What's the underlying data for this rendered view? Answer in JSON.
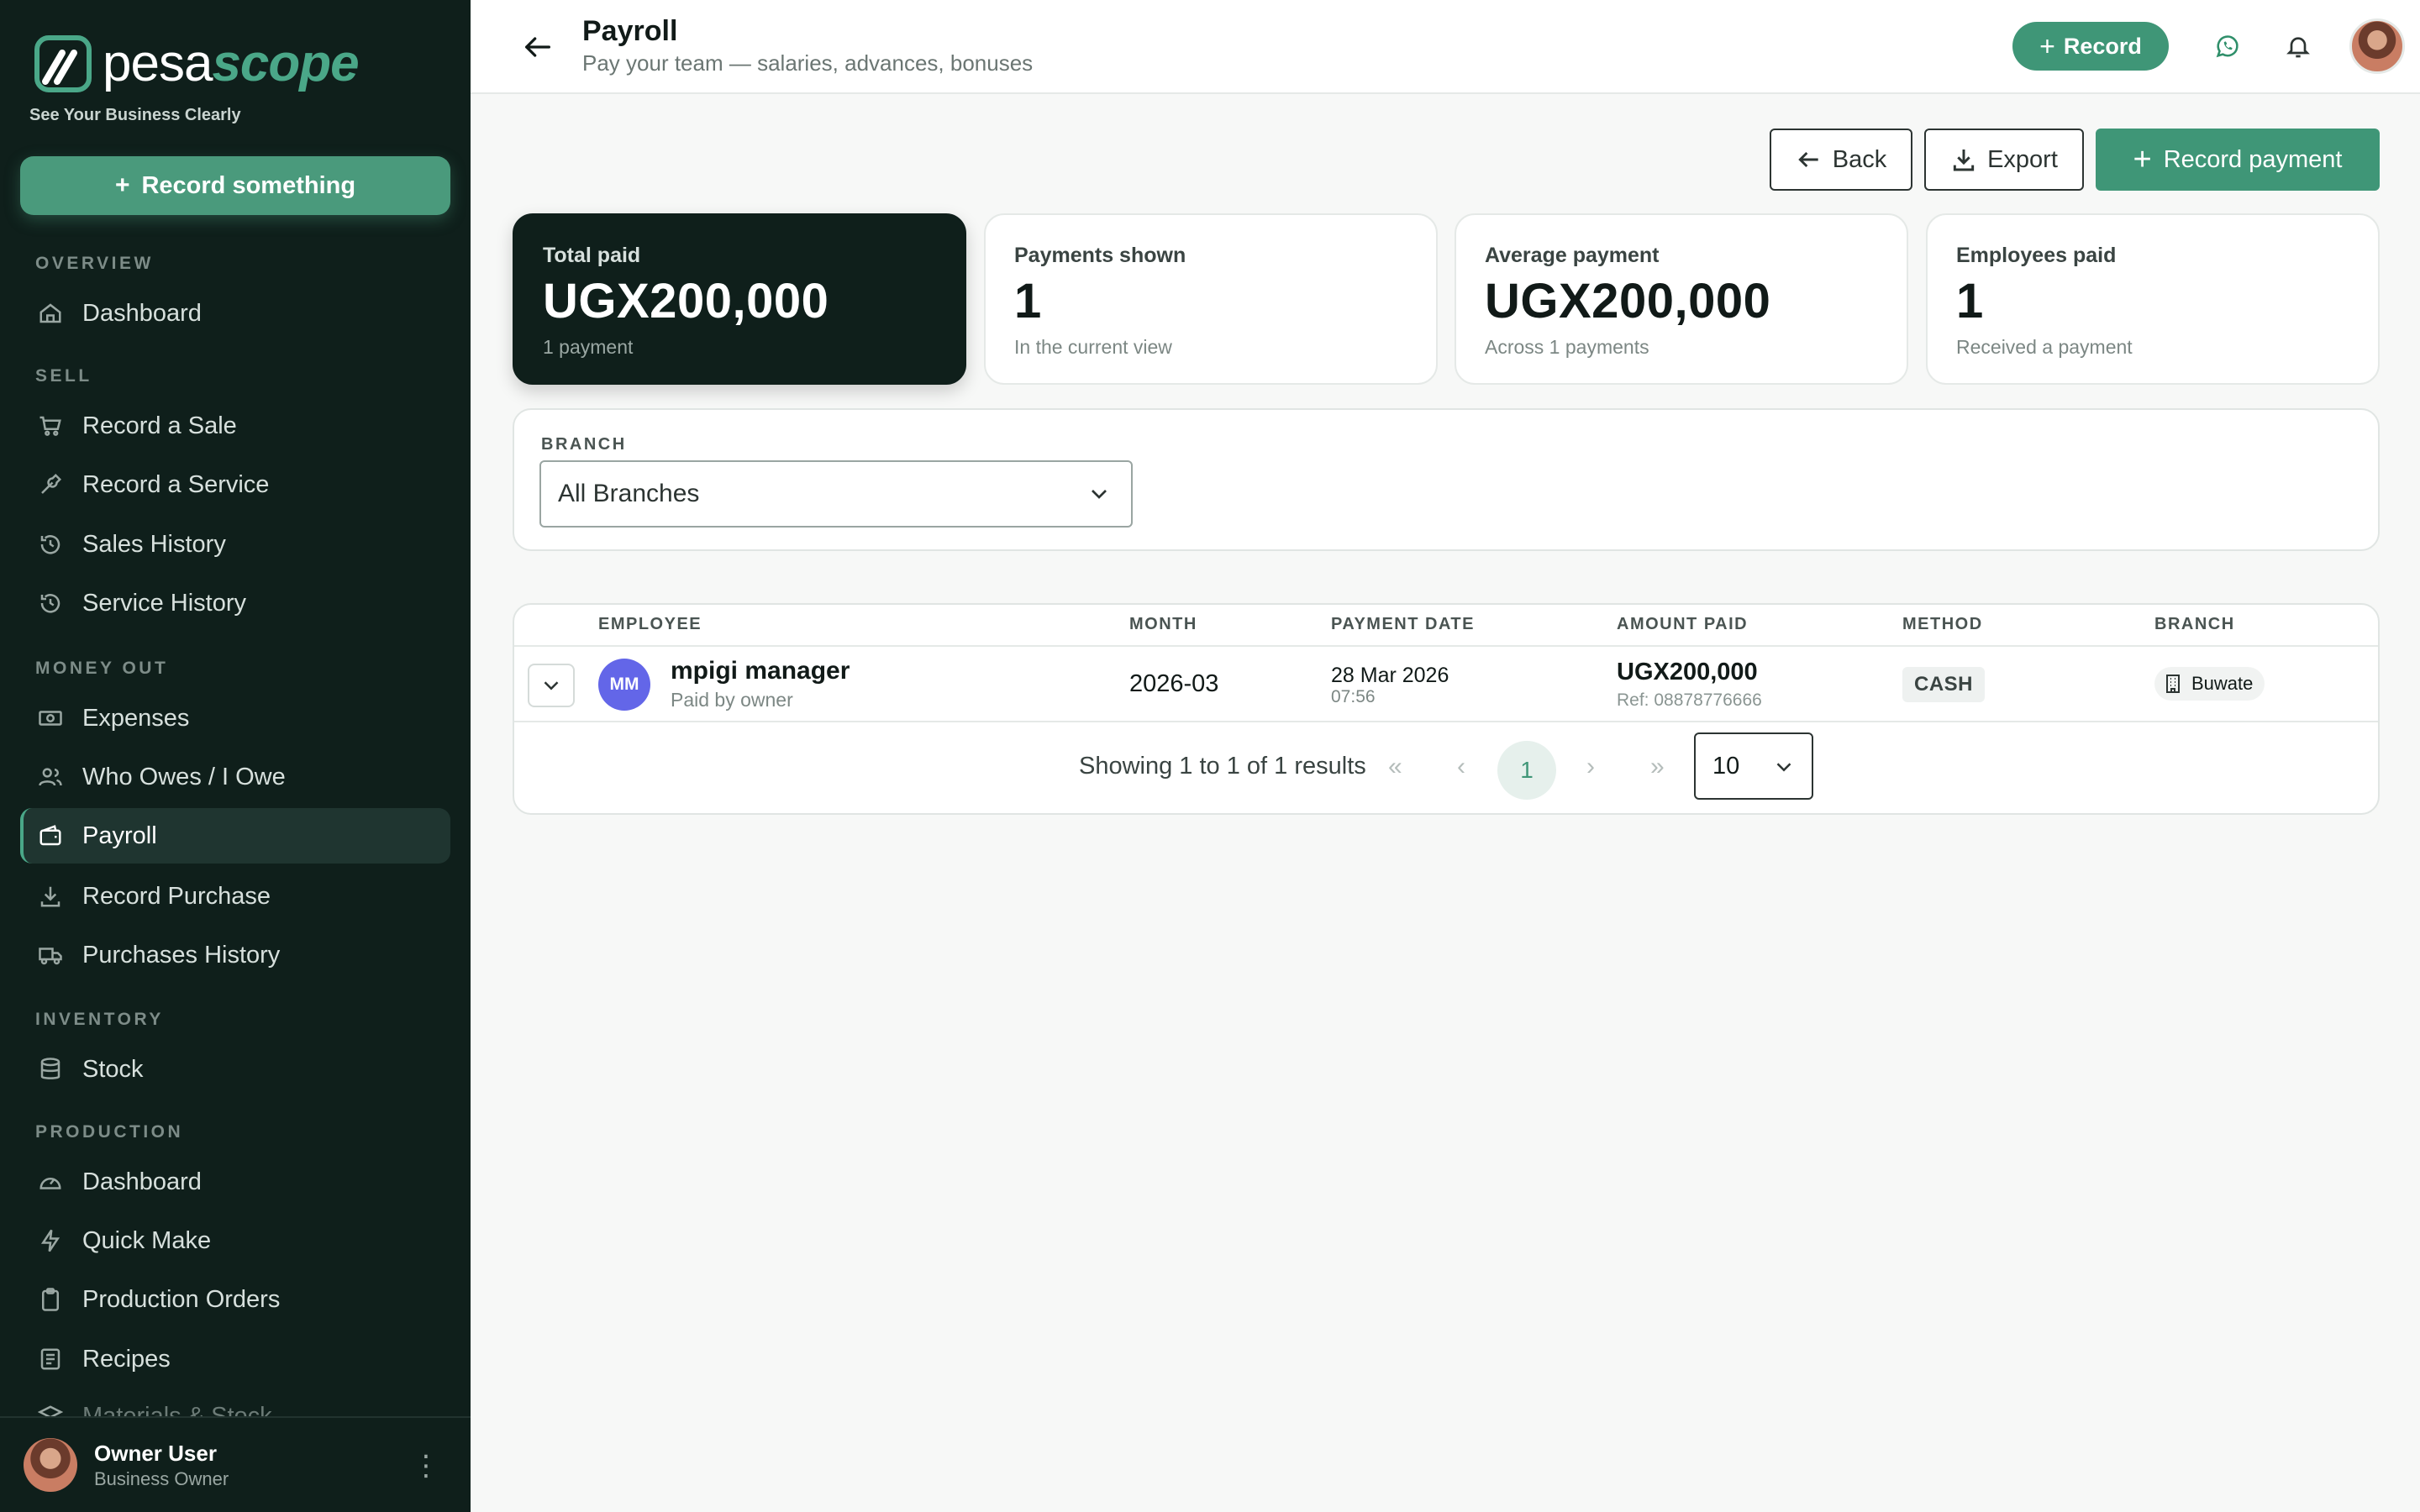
{
  "brand": {
    "name_part1": "pesa",
    "name_part2": "scope",
    "tagline": "See Your Business Clearly",
    "accent_color": "#3f9677",
    "sidebar_bg": "#0f1f1b"
  },
  "sidebar": {
    "cta_label": "Record something",
    "sections": {
      "overview": "OVERVIEW",
      "sell": "SELL",
      "money_out": "MONEY OUT",
      "inventory": "INVENTORY",
      "production": "PRODUCTION"
    },
    "items": {
      "dashboard": "Dashboard",
      "record_sale": "Record a Sale",
      "record_service": "Record a Service",
      "sales_history": "Sales History",
      "service_history": "Service History",
      "expenses": "Expenses",
      "who_owes": "Who Owes / I Owe",
      "payroll": "Payroll",
      "record_purchase": "Record Purchase",
      "purchases_history": "Purchases History",
      "stock": "Stock",
      "production_dashboard": "Dashboard",
      "quick_make": "Quick Make",
      "production_orders": "Production Orders",
      "recipes": "Recipes",
      "materials_stock": "Materials & Stock"
    },
    "active_item": "payroll",
    "user": {
      "name": "Owner User",
      "role": "Business Owner"
    }
  },
  "header": {
    "title": "Payroll",
    "subtitle": "Pay your team — salaries, advances, bonuses",
    "record_label": "Record"
  },
  "actions": {
    "back": "Back",
    "export": "Export",
    "record_payment": "Record payment"
  },
  "stats": {
    "total_paid": {
      "label": "Total paid",
      "value": "UGX200,000",
      "sub": "1 payment"
    },
    "payments_shown": {
      "label": "Payments shown",
      "value": "1",
      "sub": "In the current view"
    },
    "average_payment": {
      "label": "Average payment",
      "value": "UGX200,000",
      "sub": "Across 1 payments"
    },
    "employees_paid": {
      "label": "Employees paid",
      "value": "1",
      "sub": "Received a payment"
    }
  },
  "filter": {
    "label": "BRANCH",
    "selected": "All Branches"
  },
  "table": {
    "columns": {
      "employee": "EMPLOYEE",
      "month": "MONTH",
      "payment_date": "PAYMENT DATE",
      "amount_paid": "AMOUNT PAID",
      "method": "METHOD",
      "branch": "BRANCH"
    },
    "rows": [
      {
        "initials": "MM",
        "employee": "mpigi manager",
        "paid_by": "Paid by owner",
        "month": "2026-03",
        "date": "28 Mar 2026",
        "time": "07:56",
        "amount": "UGX200,000",
        "ref": "Ref: 08878776666",
        "method": "CASH",
        "branch": "Buwate"
      }
    ]
  },
  "pagination": {
    "summary": "Showing 1 to 1 of 1 results",
    "first": "«",
    "prev": "‹",
    "current_page": "1",
    "next": "›",
    "last": "»",
    "per_page": "10"
  }
}
